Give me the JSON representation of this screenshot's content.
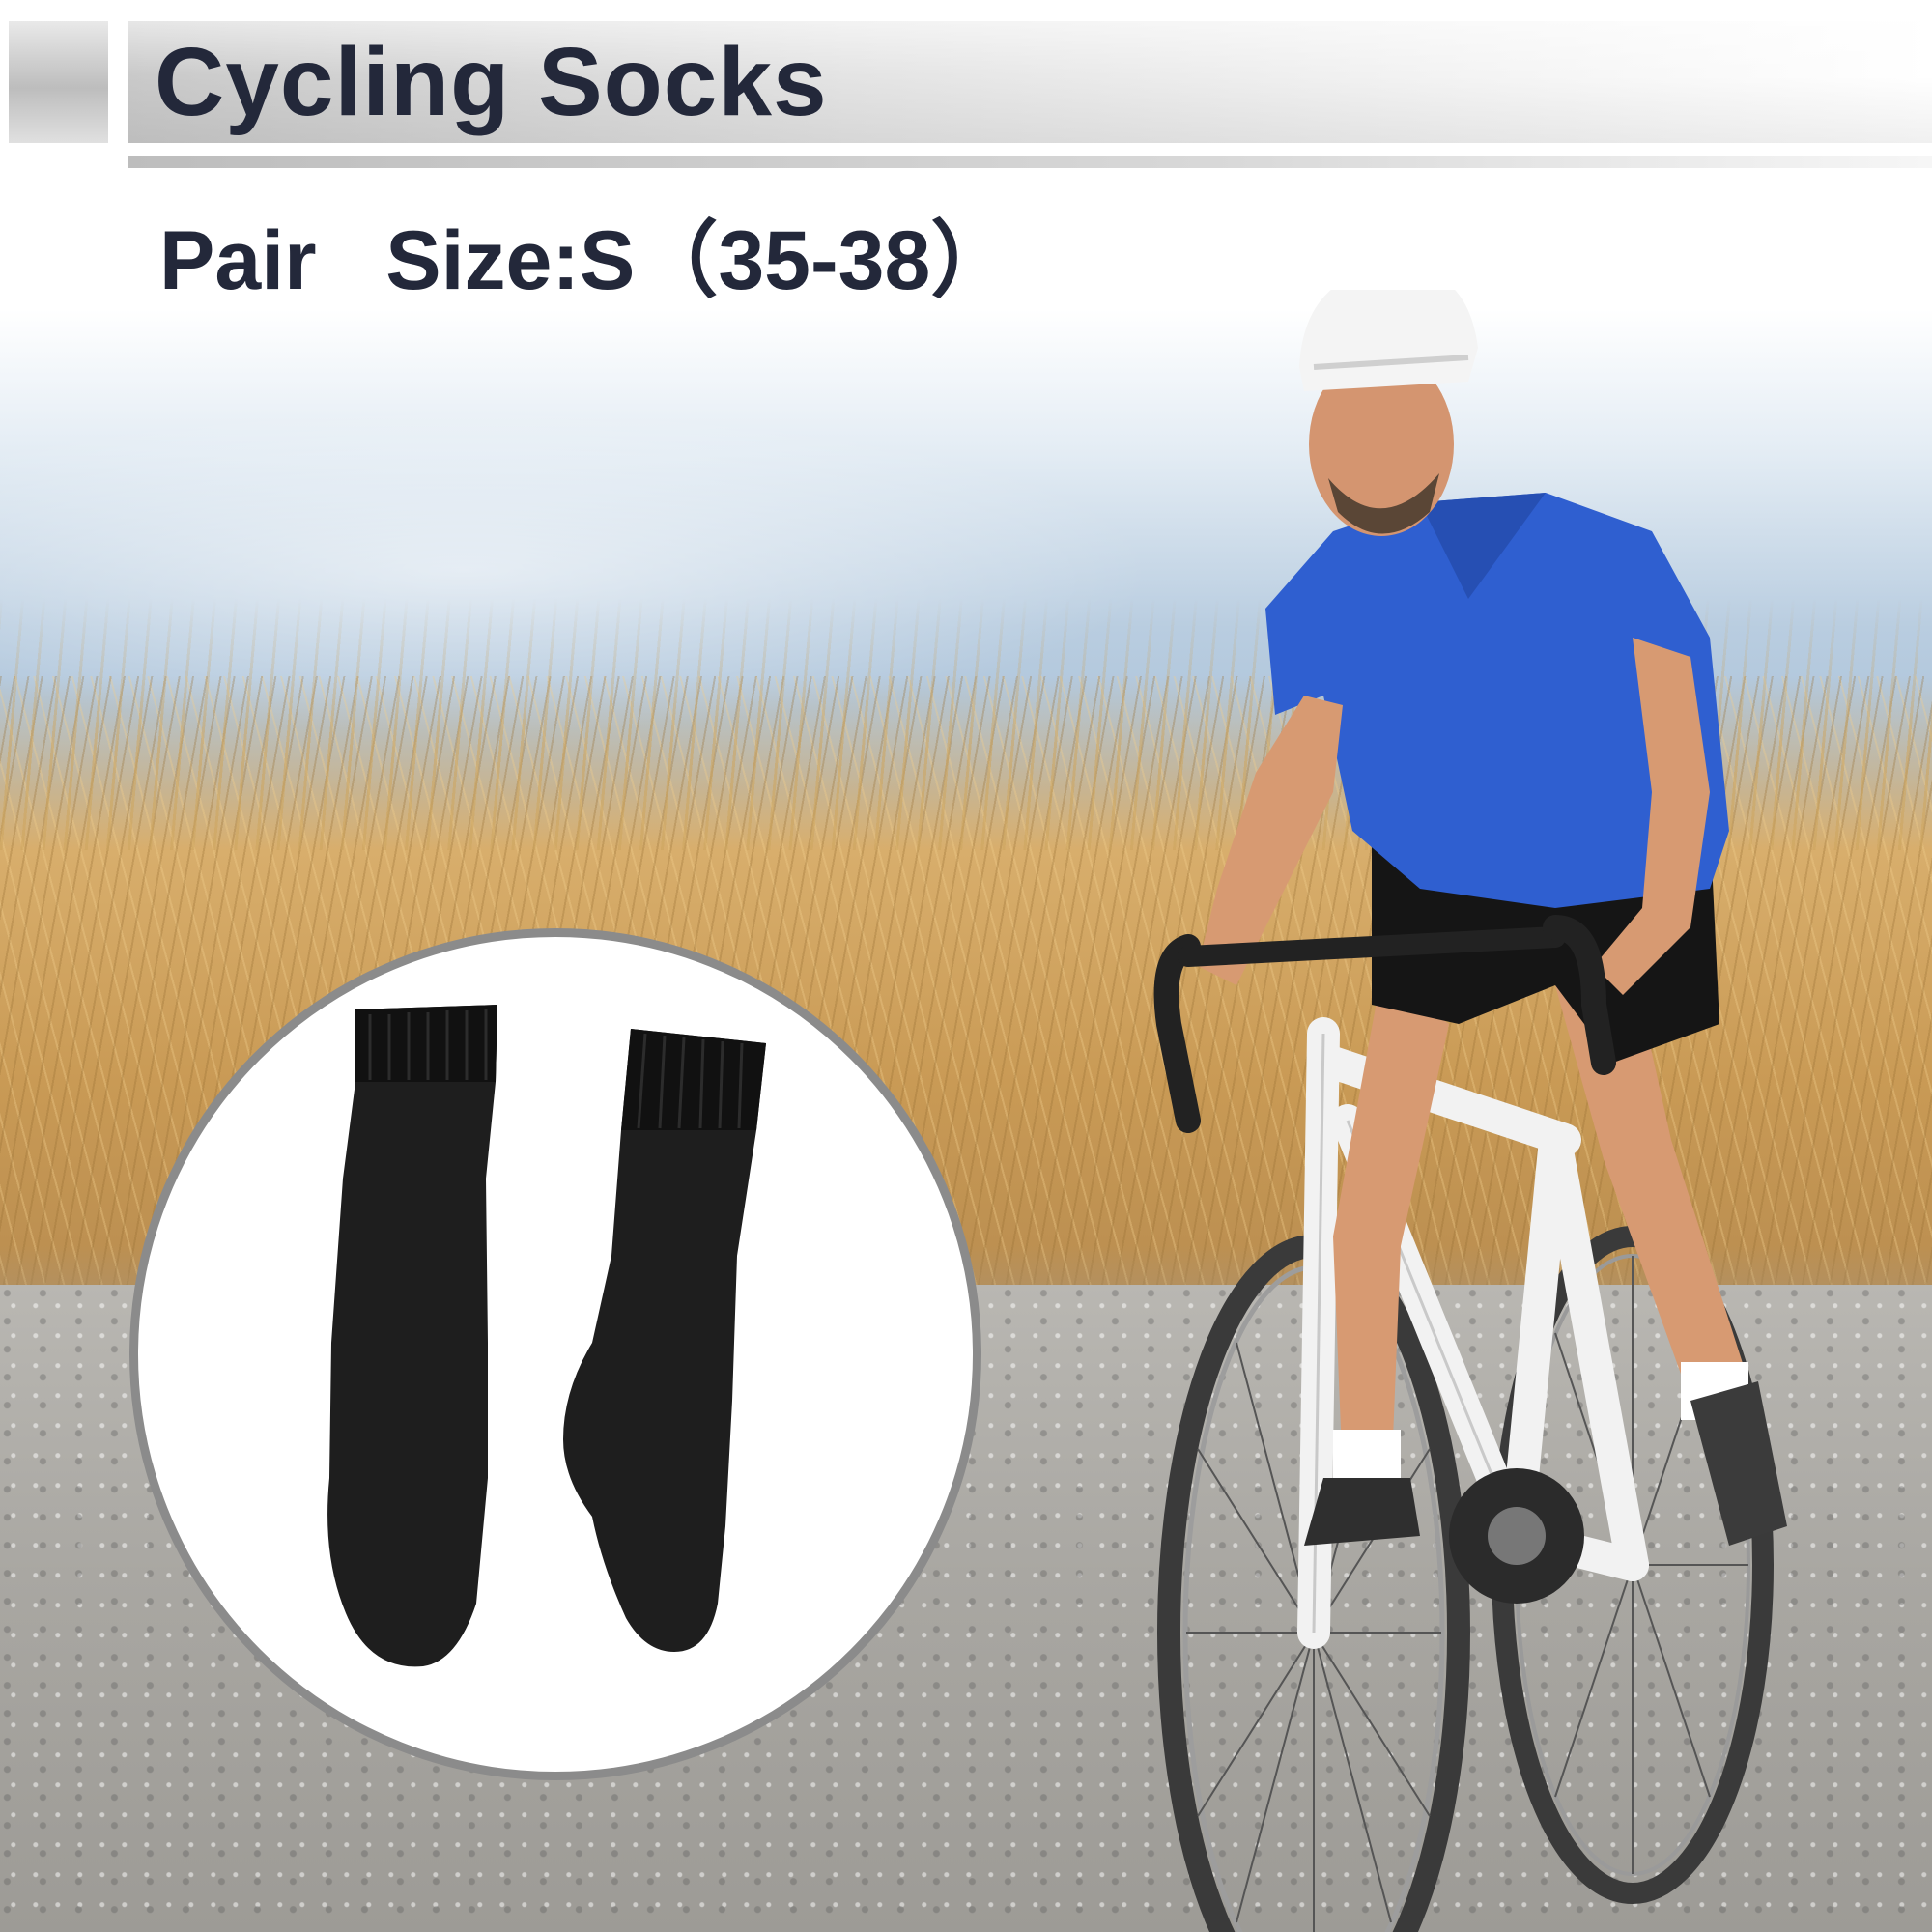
{
  "header": {
    "title": "Cycling Socks",
    "subtitle": "Pair   Size:S（35-38）"
  },
  "colors": {
    "title_text": "#23283a",
    "header_bar": "#d6d6d6",
    "circle_border": "#8b8b8b",
    "sock": "#1e1e1e",
    "jersey": "#2f5fd0",
    "sky": "#b9cde0",
    "grass": "#d2a763",
    "road": "#a9a7a2"
  }
}
